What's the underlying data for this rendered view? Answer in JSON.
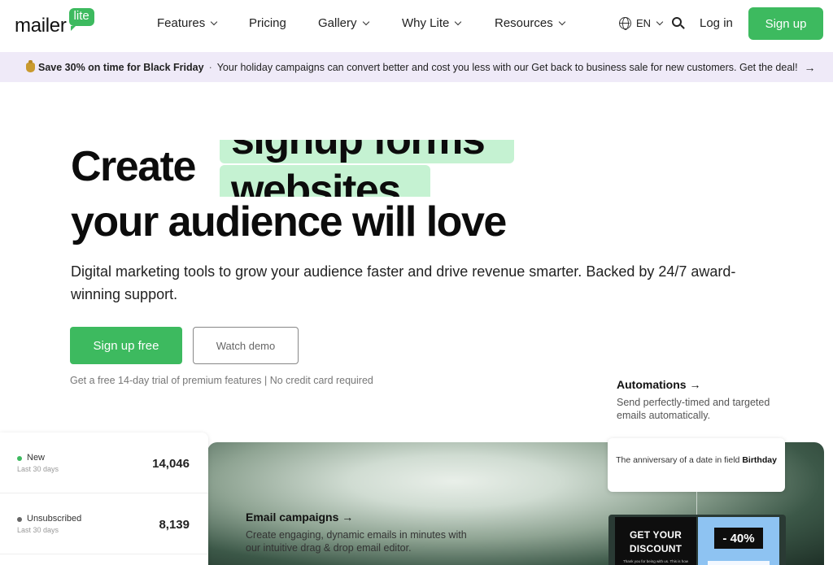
{
  "nav": {
    "logo_text": "mailer",
    "logo_badge": "lite",
    "items": [
      {
        "label": "Features",
        "has_dropdown": true
      },
      {
        "label": "Pricing",
        "has_dropdown": false
      },
      {
        "label": "Gallery",
        "has_dropdown": true
      },
      {
        "label": "Why Lite",
        "has_dropdown": true
      },
      {
        "label": "Resources",
        "has_dropdown": true
      }
    ],
    "language": "EN",
    "login": "Log in",
    "signup": "Sign up"
  },
  "promo": {
    "highlight": "Save 30% on time for Black Friday",
    "separator": "·",
    "text": "Your holiday campaigns can convert better and cost you less with our Get back to business sale for new customers. Get the deal!",
    "arrow": "→"
  },
  "hero": {
    "create": "Create",
    "rotating_words": [
      "signup forms",
      "websites"
    ],
    "line2": "your audience will love",
    "subtitle": "Digital marketing tools to grow your audience faster and drive revenue smarter. Backed by 24/7 award-winning support.",
    "cta_primary": "Sign up free",
    "cta_secondary": "Watch demo",
    "note": "Get a free 14-day trial of premium features | No credit card required"
  },
  "automations": {
    "title": "Automations →",
    "desc": "Send perfectly-timed and targeted emails automatically."
  },
  "email_campaigns": {
    "title": "Email campaigns →",
    "desc": "Create engaging, dynamic emails in minutes with our intuitive drag & drop email editor."
  },
  "stats": [
    {
      "label": "New",
      "period": "Last 30 days",
      "value": "14,046",
      "dot_color": "#3dba5f"
    },
    {
      "label": "Unsubscribed",
      "period": "Last 30 days",
      "value": "8,139",
      "dot_color": "#666666"
    }
  ],
  "anniversary": {
    "text": "The anniversary of a date in field",
    "field": "Birthday"
  },
  "email_preview": {
    "headline_line1": "GET YOUR",
    "headline_line2": "DISCOUNT",
    "fine_print": "Thank you for being with us. This is how",
    "discount": "- 40%"
  },
  "colors": {
    "brand_green": "#3dba5f",
    "promo_bg": "#efeaf8",
    "highlight_chip": "#c5f2d2"
  }
}
